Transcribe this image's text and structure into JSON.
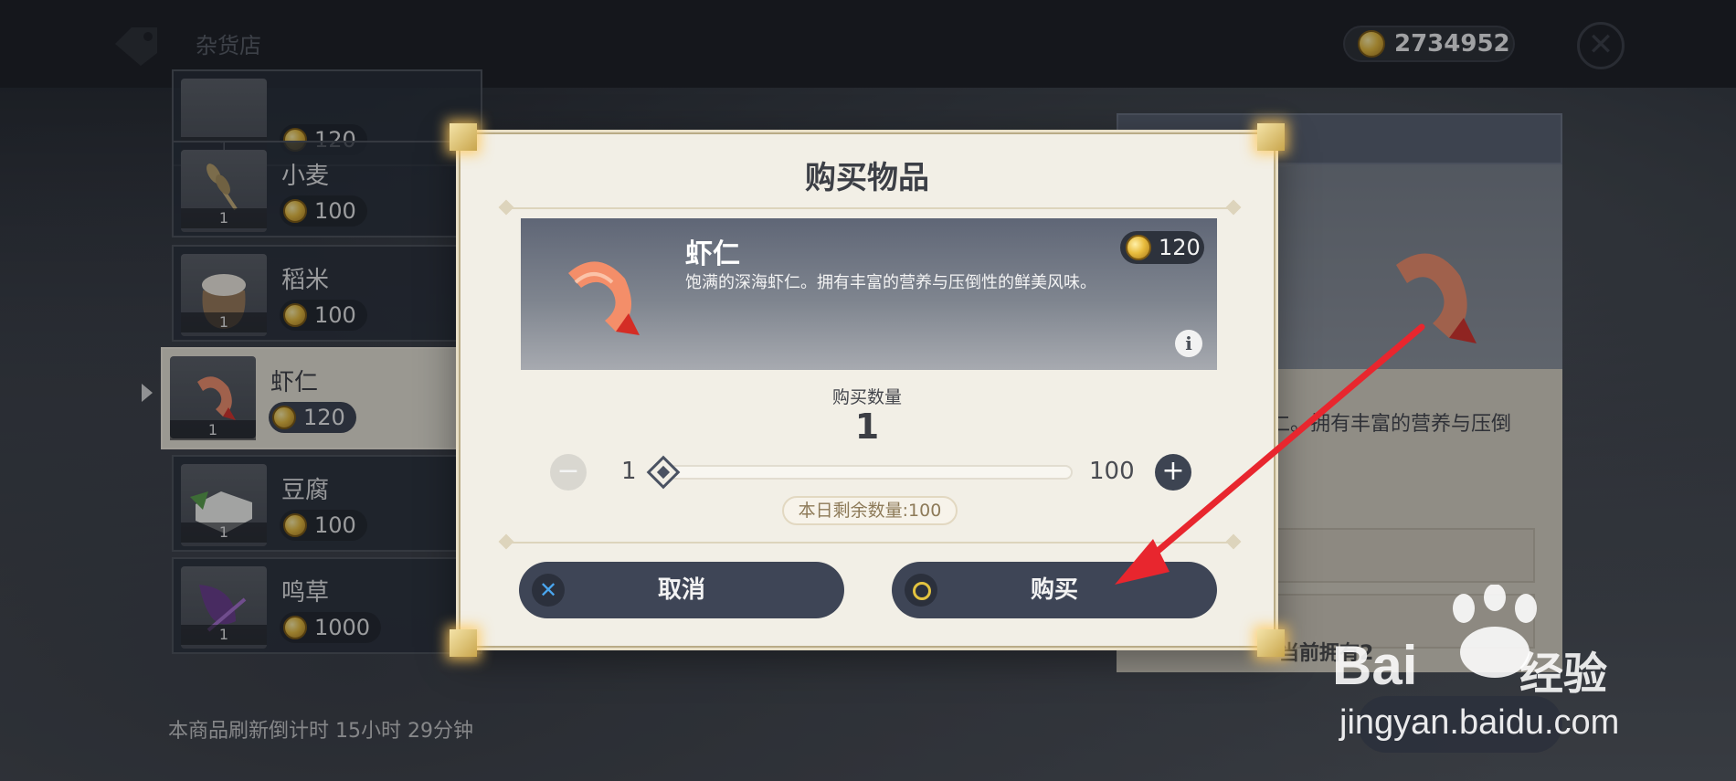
{
  "shop": {
    "title": "杂货店",
    "coins": "2734952",
    "refresh_text": "本商品刷新倒计时 15小时 29分钟"
  },
  "list": [
    {
      "name": "",
      "price": "120",
      "qty": "1"
    },
    {
      "name": "小麦",
      "price": "100",
      "qty": "1"
    },
    {
      "name": "稻米",
      "price": "100",
      "qty": "1"
    },
    {
      "name": "虾仁",
      "price": "120",
      "qty": "1"
    },
    {
      "name": "豆腐",
      "price": "100",
      "qty": "1"
    },
    {
      "name": "鸣草",
      "price": "1000",
      "qty": "1"
    }
  ],
  "detail": {
    "desc": "仁。拥有丰富的营养与压倒",
    "foot": "当前拥有2"
  },
  "dialog": {
    "title": "购买物品",
    "item_name": "虾仁",
    "item_price": "120",
    "item_desc": "饱满的深海虾仁。拥有丰富的营养与压倒性的鲜美风味。",
    "qty_label": "购买数量",
    "qty_value": "1",
    "slider_min": "1",
    "slider_max": "100",
    "slider_fraction": 0.0,
    "remaining": "本日剩余数量:100",
    "cancel_label": "取消",
    "buy_label": "购买"
  },
  "icons": {
    "coin": "gold-coin-icon",
    "close": "close-icon",
    "info": "info-icon",
    "minus": "minus-icon",
    "plus": "plus-icon",
    "cancel": "cross-icon",
    "confirm": "circle-icon"
  },
  "colors": {
    "dialog_bg": "#f2efe6",
    "button_bg": "#3e4556",
    "annotation_arrow": "#e8262e",
    "cancel_icon": "#4aa6ef",
    "confirm_icon": "#e3c340"
  },
  "watermark": {
    "brand": "Bai",
    "brand_suffix": "经验",
    "url": "jingyan.baidu.com"
  }
}
